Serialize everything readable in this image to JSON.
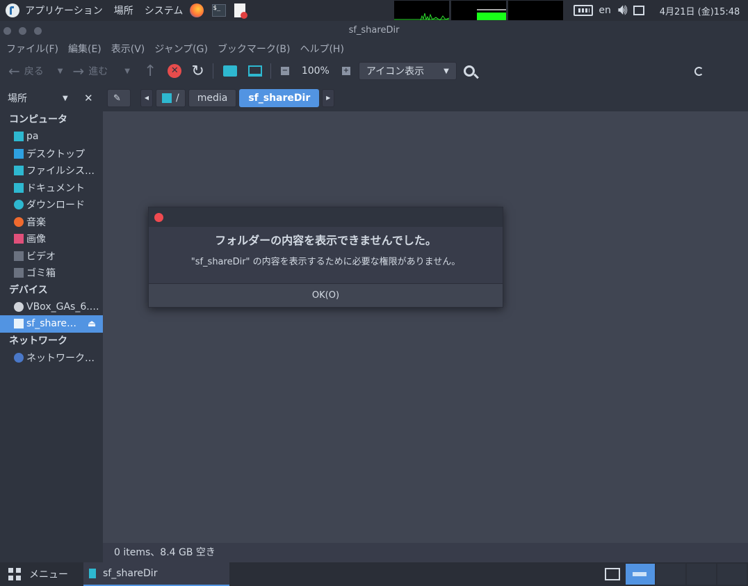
{
  "topbar": {
    "menus": [
      "アプリケーション",
      "場所",
      "システム"
    ],
    "keyboard_layout": "en",
    "clock": "4月21日 (金)15:48"
  },
  "window": {
    "title": "sf_shareDir"
  },
  "menubar": [
    "ファイル(F)",
    "編集(E)",
    "表示(V)",
    "ジャンプ(G)",
    "ブックマーク(B)",
    "ヘルプ(H)"
  ],
  "toolbar": {
    "back_label": "戻る",
    "forward_label": "進む",
    "zoom": "100%",
    "view_mode": "アイコン表示"
  },
  "sidebar": {
    "header": "場所",
    "sections": [
      {
        "title": "コンピュータ",
        "items": [
          {
            "label": "pa",
            "icon": "home-icon"
          },
          {
            "label": "デスクトップ",
            "icon": "desktop-folder-icon"
          },
          {
            "label": "ファイルシス…",
            "icon": "filesystem-icon"
          },
          {
            "label": "ドキュメント",
            "icon": "documents-icon"
          },
          {
            "label": "ダウンロード",
            "icon": "download-icon"
          },
          {
            "label": "音楽",
            "icon": "music-icon"
          },
          {
            "label": "画像",
            "icon": "pictures-icon"
          },
          {
            "label": "ビデオ",
            "icon": "video-icon"
          },
          {
            "label": "ゴミ箱",
            "icon": "trash-icon"
          }
        ]
      },
      {
        "title": "デバイス",
        "items": [
          {
            "label": "VBox_GAs_6.…",
            "icon": "disc-icon"
          },
          {
            "label": "sf_share…",
            "icon": "shared-folder-icon",
            "selected": true
          }
        ]
      },
      {
        "title": "ネットワーク",
        "items": [
          {
            "label": "ネットワーク…",
            "icon": "network-icon"
          }
        ]
      }
    ]
  },
  "pathbar": {
    "root": "/",
    "crumbs": [
      "media",
      "sf_shareDir"
    ]
  },
  "status": "0 items、8.4 GB 空き",
  "dialog": {
    "heading": "フォルダーの内容を表示できませんでした。",
    "message": "\"sf_shareDir\" の内容を表示するために必要な権限がありません。",
    "ok_label": "OK(O)"
  },
  "taskbar": {
    "menu_label": "メニュー",
    "task_label": "sf_shareDir"
  },
  "colors": {
    "accent": "#5294e2",
    "panel": "#2f343f",
    "content": "#404552",
    "close": "#f04a50"
  }
}
